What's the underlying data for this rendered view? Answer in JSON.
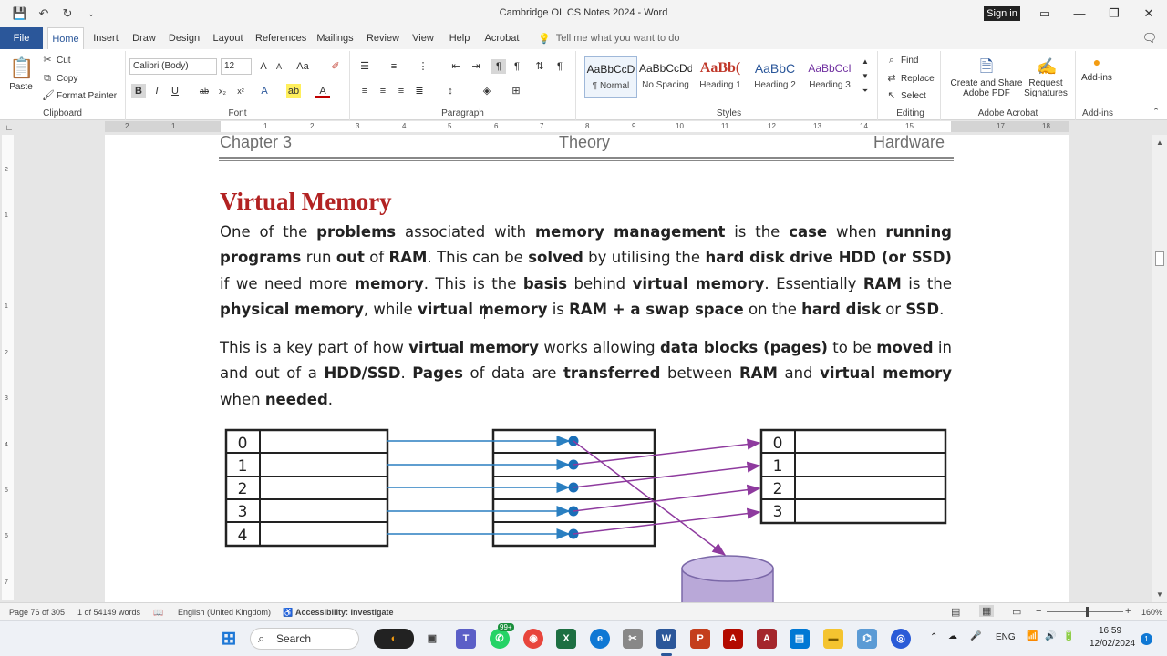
{
  "window": {
    "title": "Cambridge OL CS Notes 2024  -  Word",
    "sign_in": "Sign in"
  },
  "tabs": [
    "File",
    "Home",
    "Insert",
    "Draw",
    "Design",
    "Layout",
    "References",
    "Mailings",
    "Review",
    "View",
    "Help",
    "Acrobat"
  ],
  "tell_me": "Tell me what you want to do",
  "ribbon": {
    "clipboard": {
      "paste": "Paste",
      "cut": "Cut",
      "copy": "Copy",
      "format_painter": "Format Painter",
      "label": "Clipboard"
    },
    "font": {
      "name": "Calibri (Body)",
      "size": "12",
      "label": "Font"
    },
    "paragraph": {
      "label": "Paragraph"
    },
    "styles": {
      "items": [
        {
          "sample": "AaBbCcD",
          "name": "¶ Normal"
        },
        {
          "sample": "AaBbCcDd",
          "name": "No Spacing"
        },
        {
          "sample": "AaBb(",
          "name": "Heading 1"
        },
        {
          "sample": "AaBbC",
          "name": "Heading 2"
        },
        {
          "sample": "AaBbCcI",
          "name": "Heading 3"
        }
      ],
      "label": "Styles"
    },
    "editing": {
      "find": "Find",
      "replace": "Replace",
      "select": "Select",
      "label": "Editing"
    },
    "acrobat": {
      "create_share": "Create and Share Adobe PDF",
      "request_sig": "Request Signatures",
      "label": "Adobe Acrobat"
    },
    "addins": {
      "button": "Add-ins",
      "label": "Add-ins"
    }
  },
  "ruler_ticks": [
    "2",
    "1",
    "1",
    "2",
    "3",
    "4",
    "5",
    "6",
    "7",
    "8",
    "9",
    "10",
    "11",
    "12",
    "13",
    "14",
    "15",
    "17",
    "18"
  ],
  "vruler_ticks": [
    "2",
    "1",
    "1",
    "2",
    "3",
    "4",
    "5",
    "6",
    "7"
  ],
  "document": {
    "header_left": "Chapter 3",
    "header_center": "Theory",
    "header_right": "Hardware",
    "heading": "Virtual Memory",
    "diagram": {
      "left_rows": [
        "0",
        "1",
        "2",
        "3",
        "4"
      ],
      "right_rows": [
        "0",
        "1",
        "2",
        "3"
      ]
    }
  },
  "status": {
    "page": "Page 76 of 305",
    "words": "1 of 54149 words",
    "language": "English (United Kingdom)",
    "accessibility": "Accessibility: Investigate",
    "zoom": "160%"
  },
  "taskbar": {
    "search": "Search",
    "lang": "ENG",
    "time": "16:59",
    "date": "12/02/2024",
    "notif": "1",
    "badge": "99+"
  }
}
